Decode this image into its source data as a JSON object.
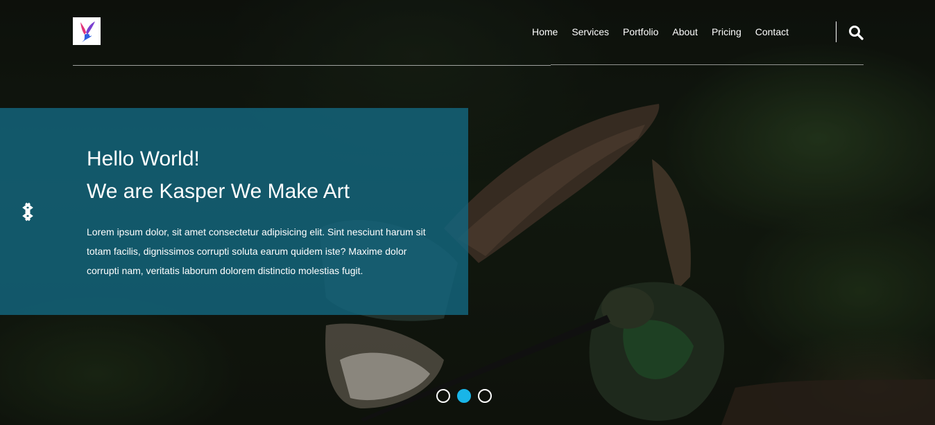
{
  "nav": {
    "items": [
      "Home",
      "Services",
      "Portfolio",
      "About",
      "Pricing",
      "Contact"
    ]
  },
  "icons": {
    "logo": "bird-logo-icon",
    "search": "search-icon",
    "prev": "double-chevron-left-icon"
  },
  "hero": {
    "title_line1": "Hello World!",
    "title_line2": "We are Kasper We Make Art",
    "description": "Lorem ipsum dolor, sit amet consectetur adipisicing elit. Sint nesciunt harum sit totam facilis, dignissimos corrupti soluta earum quidem iste? Maxime dolor corrupti nam, veritatis laborum dolorem distinctio molestias fugit."
  },
  "slider": {
    "count": 3,
    "active_index": 1
  },
  "colors": {
    "accent": "#19b5e8",
    "panel": "#13677f",
    "text": "#ffffff"
  }
}
